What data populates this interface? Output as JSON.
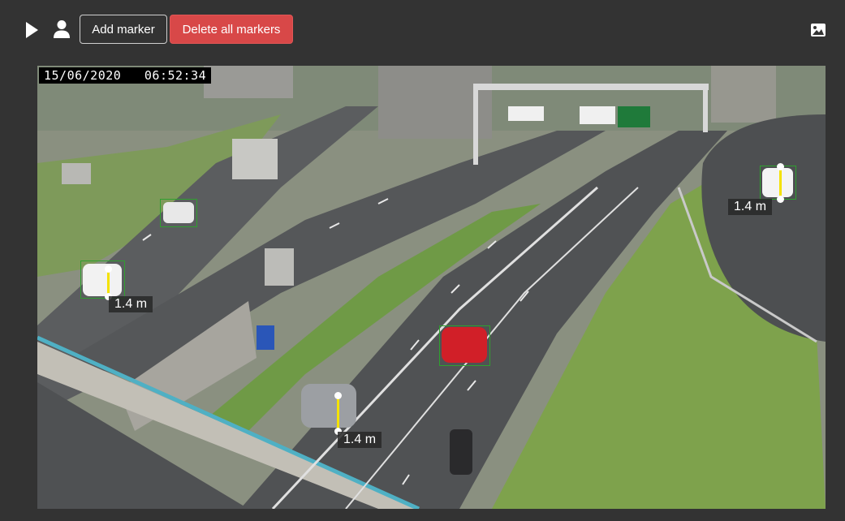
{
  "toolbar": {
    "play_icon": "play-icon",
    "user_icon": "user-icon",
    "add_marker_label": "Add marker",
    "delete_all_label": "Delete all markers",
    "image_icon": "image-icon",
    "delete_color": "#d84848"
  },
  "camera": {
    "date": "15/06/2020",
    "time": "06:52:34",
    "timestamp": "15/06/2020   06:52:34"
  },
  "markers": [
    {
      "label": "1.4 m"
    },
    {
      "label": "1.4 m"
    },
    {
      "label": "1.4 m"
    }
  ],
  "colors": {
    "background": "#333333",
    "marker_line": "#f4e200",
    "bbox": "#2fa02f"
  }
}
